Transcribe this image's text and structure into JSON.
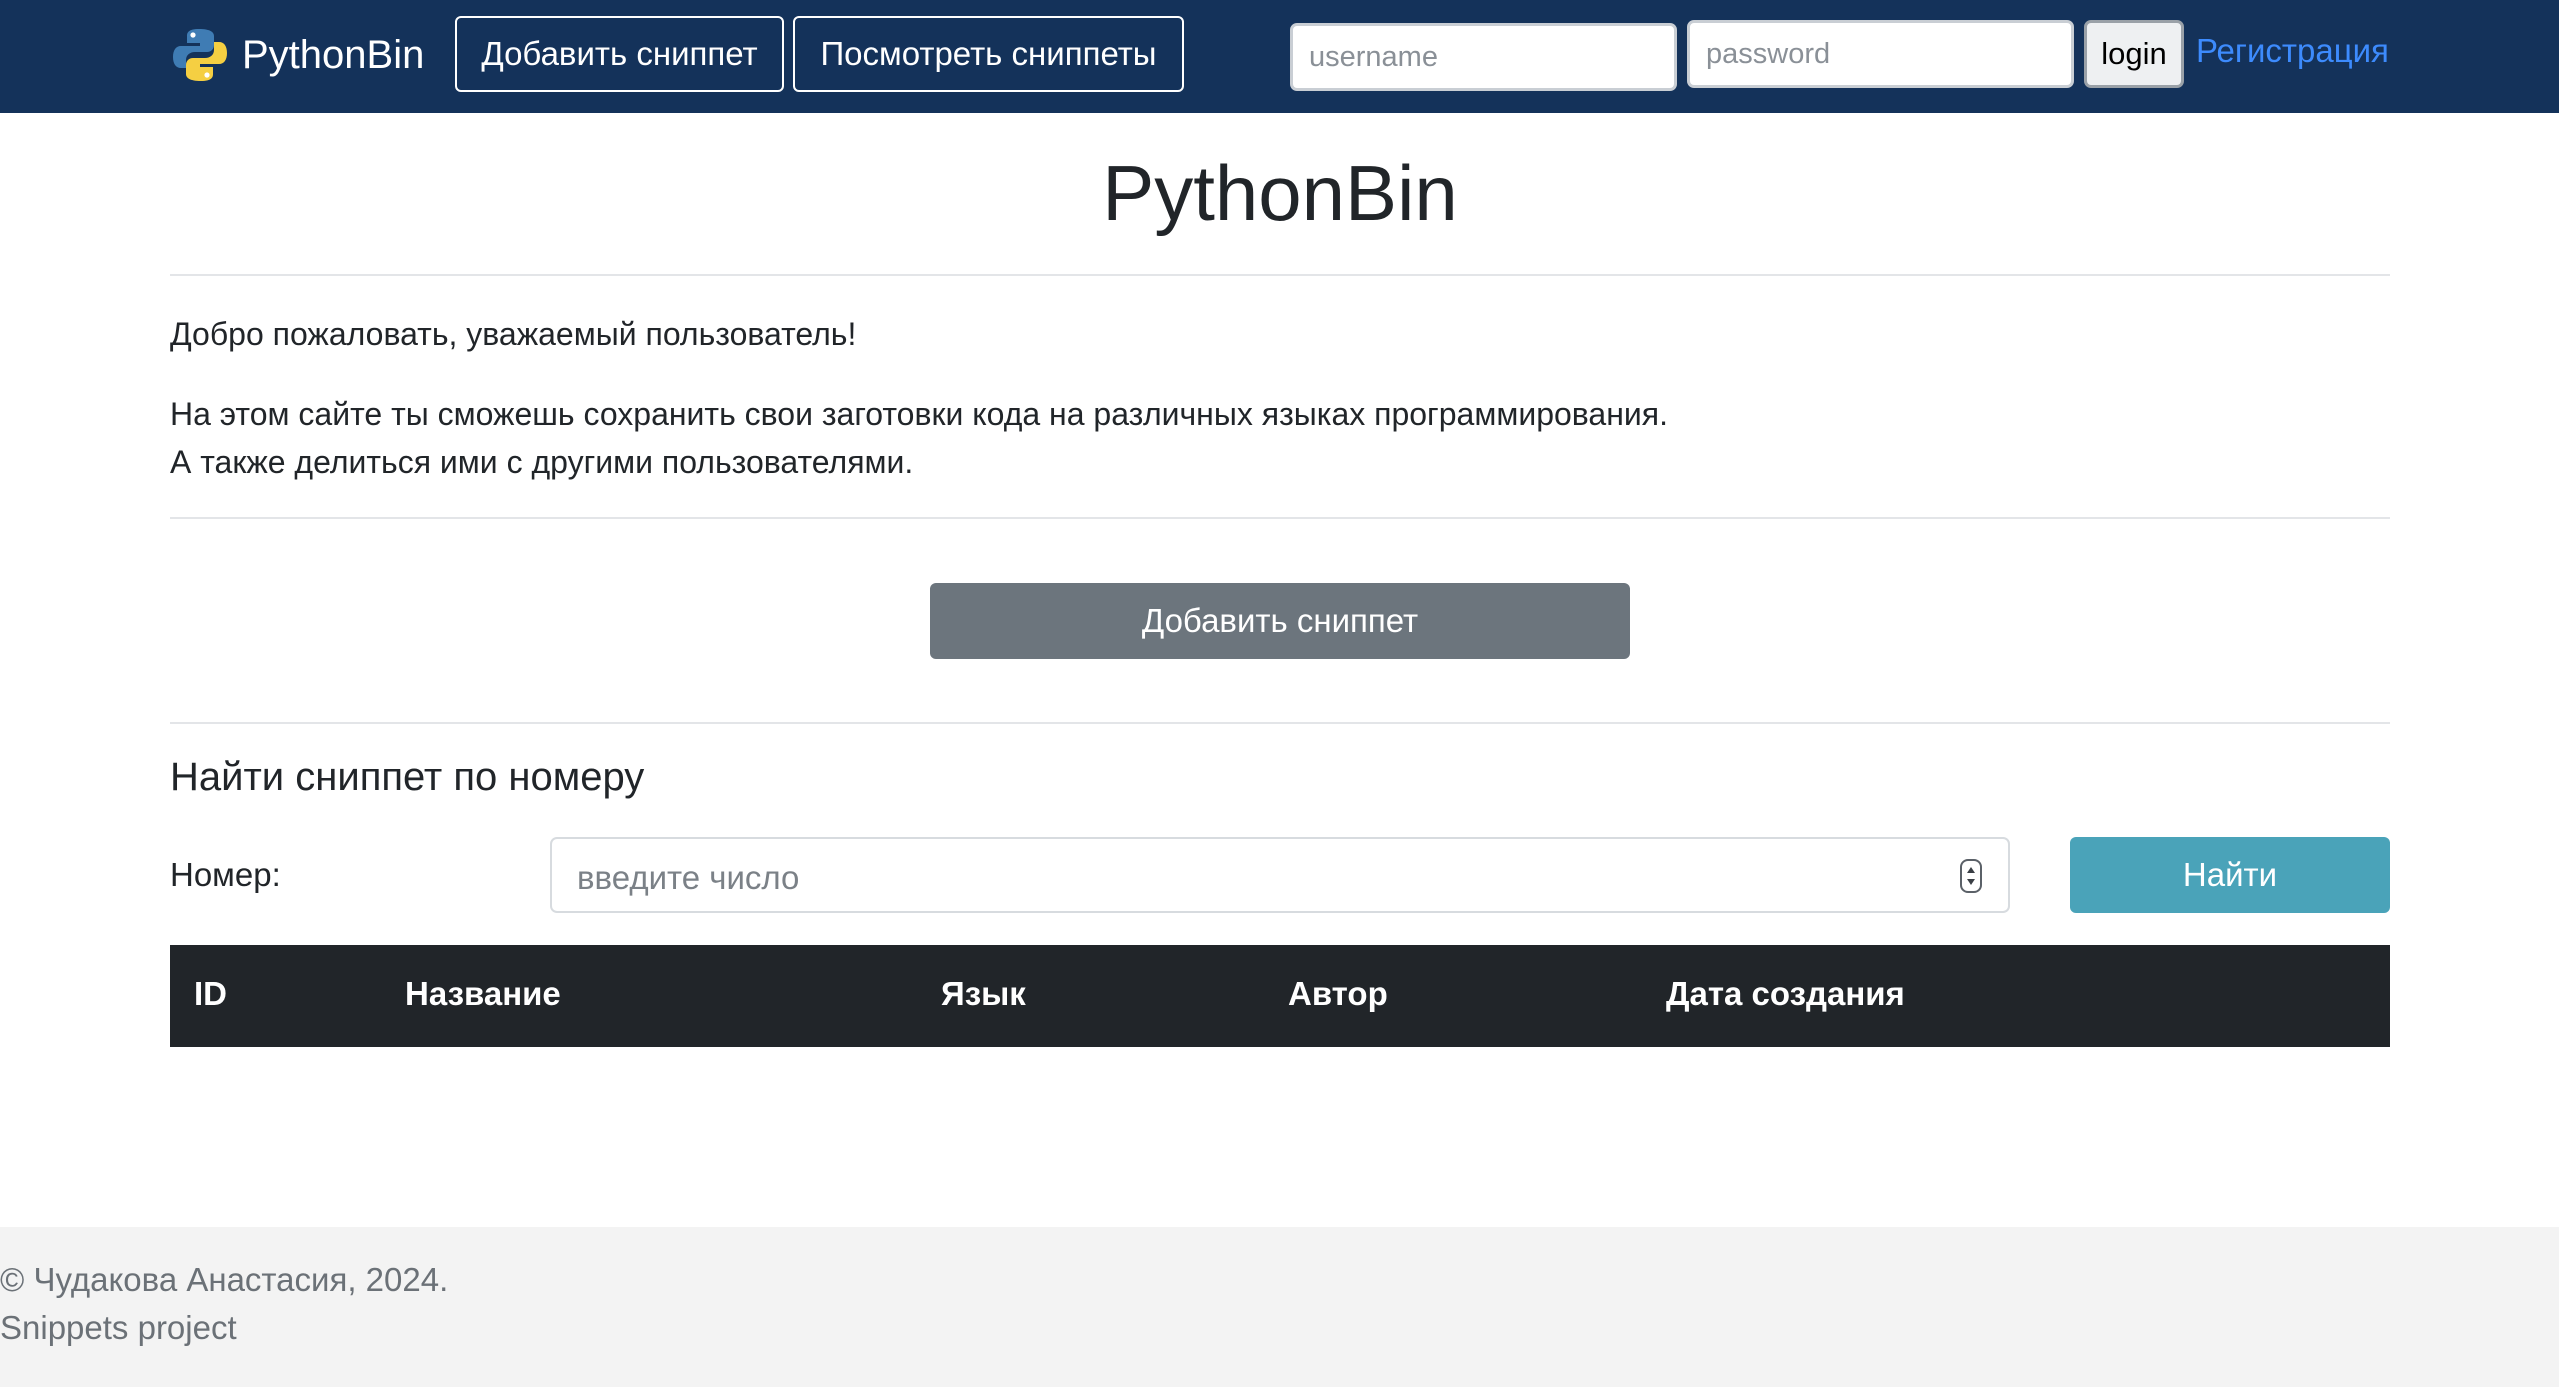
{
  "navbar": {
    "brand": "PythonBin",
    "add_snippet": "Добавить сниппет",
    "view_snippets": "Посмотреть сниппеты",
    "username_placeholder": "username",
    "password_placeholder": "password",
    "login_label": "login",
    "register_label": "Регистрация"
  },
  "main": {
    "title": "PythonBin",
    "welcome": "Добро пожаловать, уважаемый пользователь!",
    "description_line1": "На этом сайте ты сможешь сохранить свои заготовки кода на различных языках программирования.",
    "description_line2": "А также делиться ими с другими пользователями.",
    "add_snippet_button": "Добавить сниппет"
  },
  "search": {
    "heading": "Найти сниппет по номеру",
    "number_label": "Номер:",
    "number_placeholder": "введите число",
    "find_button": "Найти"
  },
  "table": {
    "columns": [
      "ID",
      "Название",
      "Язык",
      "Автор",
      "Дата создания"
    ],
    "rows": []
  },
  "footer": {
    "line1": "© Чудакова Анастасия, 2024.",
    "line2": "Snippets project"
  },
  "colors": {
    "navbar_bg": "#14325a",
    "add_button_bg": "#6c757d",
    "find_button_bg": "#4aa3b9",
    "table_head_bg": "#212529",
    "link": "#3d8bfd",
    "footer_bg": "#f3f3f3"
  },
  "icons": {
    "brand_logo": "python-logo-icon",
    "number_spinner": "spinner-arrows-icon"
  }
}
